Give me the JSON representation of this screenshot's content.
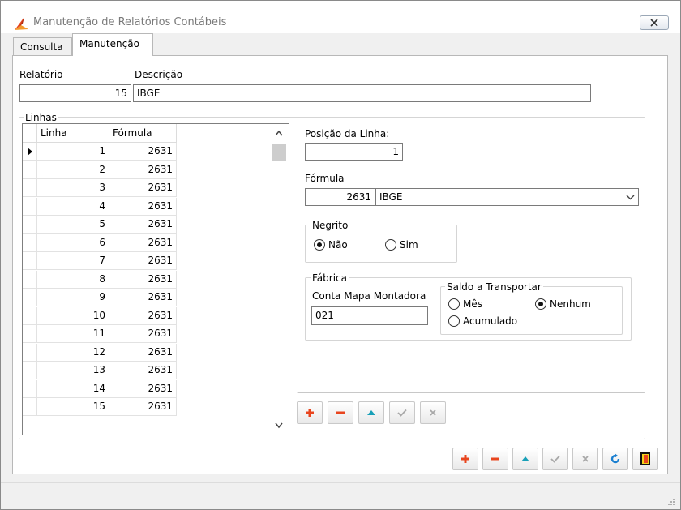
{
  "window": {
    "title": "Manutenção de Relatórios Contábeis"
  },
  "tabs": [
    {
      "label": "Consulta"
    },
    {
      "label": "Manutenção"
    }
  ],
  "header": {
    "relatorio_label": "Relatório",
    "relatorio_value": "15",
    "descricao_label": "Descrição",
    "descricao_value": "IBGE"
  },
  "linhas": {
    "caption": "Linhas",
    "columns": [
      "Linha",
      "Fórmula"
    ],
    "rows": [
      {
        "linha": "1",
        "formula": "2631"
      },
      {
        "linha": "2",
        "formula": "2631"
      },
      {
        "linha": "3",
        "formula": "2631"
      },
      {
        "linha": "4",
        "formula": "2631"
      },
      {
        "linha": "5",
        "formula": "2631"
      },
      {
        "linha": "6",
        "formula": "2631"
      },
      {
        "linha": "7",
        "formula": "2631"
      },
      {
        "linha": "8",
        "formula": "2631"
      },
      {
        "linha": "9",
        "formula": "2631"
      },
      {
        "linha": "10",
        "formula": "2631"
      },
      {
        "linha": "11",
        "formula": "2631"
      },
      {
        "linha": "12",
        "formula": "2631"
      },
      {
        "linha": "13",
        "formula": "2631"
      },
      {
        "linha": "14",
        "formula": "2631"
      },
      {
        "linha": "15",
        "formula": "2631"
      }
    ]
  },
  "detail": {
    "posicao_label": "Posição da Linha:",
    "posicao_value": "1",
    "formula_label": "Fórmula",
    "formula_code": "2631",
    "formula_desc": "IBGE",
    "negrito": {
      "caption": "Negrito",
      "options": [
        "Não",
        "Sim"
      ],
      "selected": "Não"
    },
    "fabrica": {
      "caption": "Fábrica",
      "conta_label": "Conta Mapa Montadora",
      "conta_value": "021",
      "saldo": {
        "caption": "Saldo a Transportar",
        "options": [
          "Mês",
          "Nenhum",
          "Acumulado"
        ],
        "selected": "Nenhum"
      }
    }
  },
  "icons": {
    "add": "plus-icon",
    "remove": "minus-icon",
    "up": "triangle-up-icon",
    "confirm": "check-icon",
    "cancel": "x-icon",
    "refresh": "refresh-icon",
    "exit": "exit-door-icon"
  },
  "colors": {
    "add": "#e8451e",
    "remove": "#e8451e",
    "up": "#18a0b8",
    "disabled": "#a8a8a8",
    "refresh": "#1a7fd0",
    "exit": "#f2d21c"
  }
}
